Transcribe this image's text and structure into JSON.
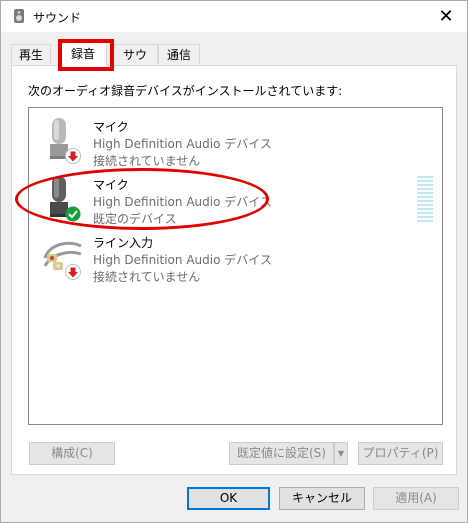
{
  "window": {
    "title": "サウンド",
    "close_glyph": "✕"
  },
  "tabs": [
    {
      "label": "再生",
      "active": false
    },
    {
      "label": "録音",
      "active": true
    },
    {
      "label": "サウンド",
      "active": false
    },
    {
      "label": "通信",
      "active": false
    }
  ],
  "panel": {
    "instructions": "次のオーディオ録音デバイスがインストールされています:"
  },
  "devices": [
    {
      "name": "マイク",
      "description": "High Definition Audio デバイス",
      "status": "接続されていません",
      "icon": "microphone-icon",
      "badge": "disconnected-arrow-icon",
      "selected": false
    },
    {
      "name": "マイク",
      "description": "High Definition Audio デバイス",
      "status": "既定のデバイス",
      "icon": "microphone-icon",
      "badge": "default-check-icon",
      "selected": true
    },
    {
      "name": "ライン入力",
      "description": "High Definition Audio デバイス",
      "status": "接続されていません",
      "icon": "line-in-cable-icon",
      "badge": "disconnected-arrow-icon",
      "selected": false
    }
  ],
  "buttons": {
    "configure": "構成(C)",
    "set_default": "既定値に設定(S)",
    "properties": "プロパティ(P)",
    "ok": "OK",
    "cancel": "キャンセル",
    "apply": "適用(A)"
  },
  "colors": {
    "highlight": "#e20000",
    "default_button_border": "#0078d7",
    "check_badge": "#1a9e3a",
    "arrow_badge": "#d42020"
  }
}
